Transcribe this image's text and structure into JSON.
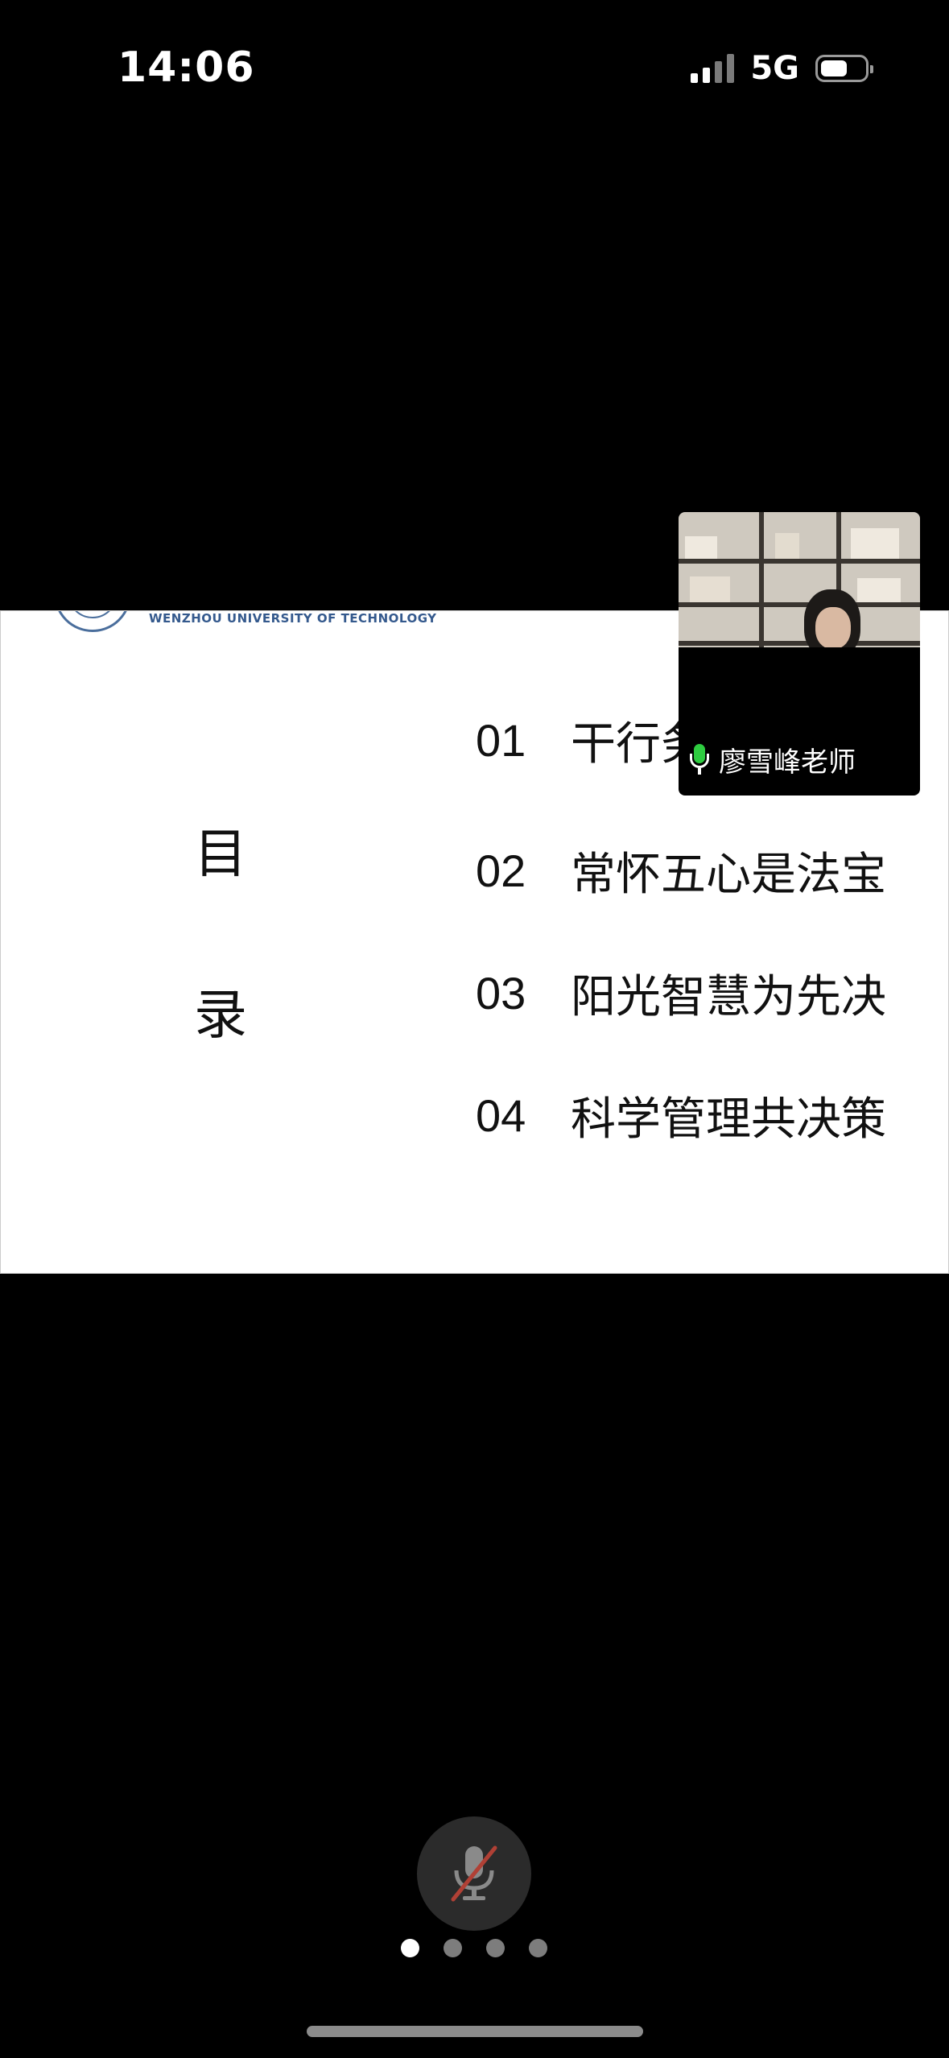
{
  "status_bar": {
    "time": "14:06",
    "network": "5G"
  },
  "slide": {
    "university_name": "WENZHOU UNIVERSITY OF TECHNOLOGY",
    "title_chars": [
      "目",
      "录"
    ],
    "toc": [
      {
        "num": "01",
        "text": "干行务"
      },
      {
        "num": "02",
        "text": "常怀五心是法宝"
      },
      {
        "num": "03",
        "text": "阳光智慧为先决"
      },
      {
        "num": "04",
        "text": "科学管理共决策"
      }
    ]
  },
  "participant": {
    "name": "廖雪峰老师",
    "mic_on": true
  },
  "controls": {
    "mic_muted": true
  },
  "pager": {
    "count": 4,
    "active_index": 0
  },
  "colors": {
    "accent_green": "#2ecc40",
    "mute_slash": "#b04035",
    "university_blue": "#34598d"
  }
}
